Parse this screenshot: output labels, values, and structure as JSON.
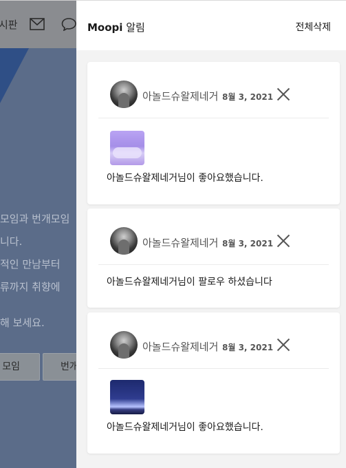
{
  "background": {
    "nav_text": "시판",
    "lines": [
      "모임과 번개모임",
      "니다.",
      "적인 만남부터",
      "류까지 취향에",
      "해 보세요."
    ],
    "button1": "모임",
    "button2": "번개"
  },
  "panel": {
    "title_brand": "Moopi",
    "title_rest": " 알림",
    "clear_all": "전체삭제"
  },
  "notifications": [
    {
      "user": "아놀드슈왈제네거",
      "date": "8월 3, 2021",
      "thumbnail": "purple-clouds",
      "message": "아놀드슈왈제네거님이 좋아요했습니다."
    },
    {
      "user": "아놀드슈왈제네거",
      "date": "8월 3, 2021",
      "message": "아놀드슈왈제네거님이 팔로우 하셨습니다"
    },
    {
      "user": "아놀드슈왈제네거",
      "date": "8월 3, 2021",
      "thumbnail": "night-sky",
      "message": "아놀드슈왈제네거님이 좋아요했습니다."
    }
  ]
}
